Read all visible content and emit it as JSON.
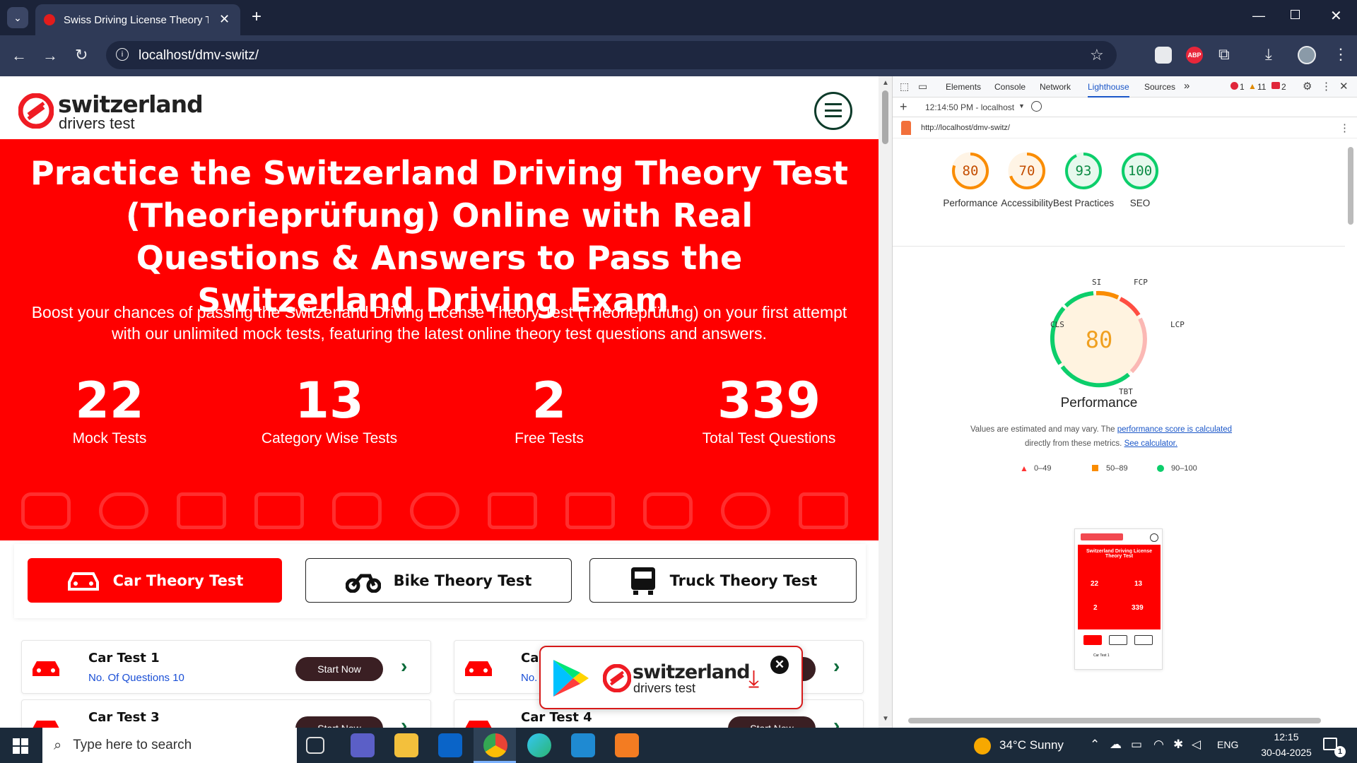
{
  "browser": {
    "tab_title": "Swiss Driving License Theory Te",
    "url": "localhost/dmv-switz/",
    "new_tab_symbol": "+"
  },
  "site": {
    "logo_main": "switzerland",
    "logo_sub": "drivers test",
    "hero_title": "Practice the Switzerland Driving Theory Test (Theorieprüfung) Online with Real Questions & Answers to Pass the Switzerland Driving Exam.",
    "hero_sub": "Boost your chances of passing the Switzerland Driving License Theory Test (Theorieprüfung) on your first attempt with our unlimited mock tests, featuring the latest online theory test questions and answers.",
    "stats": [
      {
        "num": "22",
        "label": "Mock Tests"
      },
      {
        "num": "13",
        "label": "Category Wise Tests"
      },
      {
        "num": "2",
        "label": "Free Tests"
      },
      {
        "num": "339",
        "label": "Total Test Questions"
      }
    ],
    "category_tabs": [
      "Car Theory Test",
      "Bike Theory Test",
      "Truck Theory Test"
    ],
    "tests": [
      {
        "title": "Car Test 1",
        "sub": "No. Of Questions 10",
        "btn": "Start Now"
      },
      {
        "title": "Ca",
        "sub": "No.",
        "btn": ""
      },
      {
        "title": "Car Test 3",
        "sub": "",
        "btn": "Start Now"
      },
      {
        "title": "Car Test 4",
        "sub": "",
        "btn": "Start Now"
      }
    ],
    "popup_logo_main": "switzerland",
    "popup_logo_sub": "drivers test"
  },
  "devtools": {
    "tabs": [
      "Elements",
      "Console",
      "Network",
      "Lighthouse",
      "Sources"
    ],
    "active_tab": "Lighthouse",
    "errors": "1",
    "warnings": "11",
    "issues": "2",
    "report_time": "12:14:50 PM - localhost",
    "report_url": "http://localhost/dmv-switz/",
    "scores": [
      {
        "value": "80",
        "label": "Performance",
        "color": "#fa8c00"
      },
      {
        "value": "70",
        "label": "Accessibility",
        "color": "#fa8c00"
      },
      {
        "value": "93",
        "label": "Best Practices",
        "color": "#0cce6b"
      },
      {
        "value": "100",
        "label": "SEO",
        "color": "#0cce6b"
      }
    ],
    "perf_score": "80",
    "perf_title": "Performance",
    "metrics": [
      "SI",
      "FCP",
      "LCP",
      "TBT",
      "CLS"
    ],
    "note_1": "Values are estimated and may vary. The ",
    "note_link_1": "performance score is calculated",
    "note_2": "directly from these metrics. ",
    "note_link_2": "See calculator.",
    "legend": [
      "0–49",
      "50–89",
      "90–100"
    ],
    "thumb": {
      "title": "Switzerland Driving License Theory Test",
      "stats": [
        "22",
        "13",
        "2",
        "339"
      ],
      "row": "Car Test 1"
    }
  },
  "taskbar": {
    "search_placeholder": "Type here to search",
    "weather": "34°C  Sunny",
    "lang": "ENG",
    "time": "12:15",
    "date": "30-04-2025",
    "notif_count": "1"
  }
}
